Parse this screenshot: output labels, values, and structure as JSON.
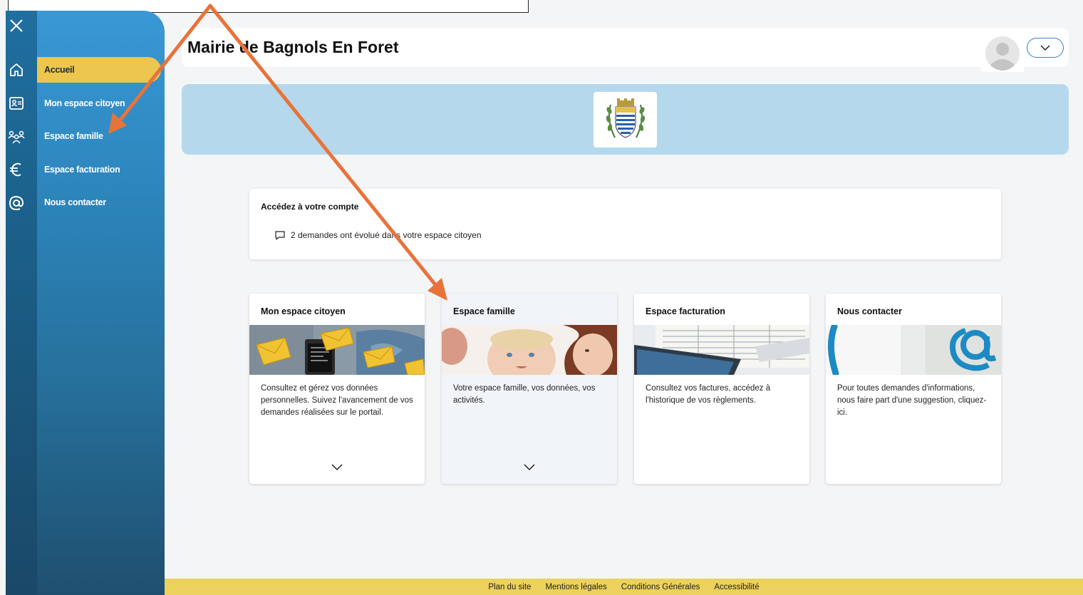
{
  "header": {
    "title": "Mairie de Bagnols En Foret"
  },
  "sidebar": {
    "items": [
      {
        "label": "Accueil",
        "icon": "home-icon"
      },
      {
        "label": "Mon espace citoyen",
        "icon": "id-card-icon"
      },
      {
        "label": "Espace famille",
        "icon": "family-icon"
      },
      {
        "label": "Espace facturation",
        "icon": "euro-icon"
      },
      {
        "label": "Nous contacter",
        "icon": "at-icon"
      }
    ]
  },
  "account": {
    "title": "Accédez à votre compte",
    "notification": "2 demandes ont évolué dans votre espace citoyen"
  },
  "cards": [
    {
      "title": "Mon espace citoyen",
      "text": "Consultez et gérez vos données personnelles. Suivez l'avancement de vos demandes réalisées sur le portail."
    },
    {
      "title": "Espace famille",
      "text": "Votre espace famille, vos données, vos activités."
    },
    {
      "title": "Espace facturation",
      "text": "Consultez vos factures, accédez à l'historique de vos règlements."
    },
    {
      "title": "Nous contacter",
      "text": "Pour toutes demandes d'informations, nous faire part d'une suggestion, cliquez-ici."
    }
  ],
  "footer": {
    "links": [
      "Plan du site",
      "Mentions légales",
      "Conditions Générales",
      "Accessibilité"
    ]
  },
  "colors": {
    "sidebar_active": "#ecc64f",
    "banner": "#b6d8ec",
    "footer": "#ecd15c",
    "annotation_arrow": "#e8733a"
  }
}
